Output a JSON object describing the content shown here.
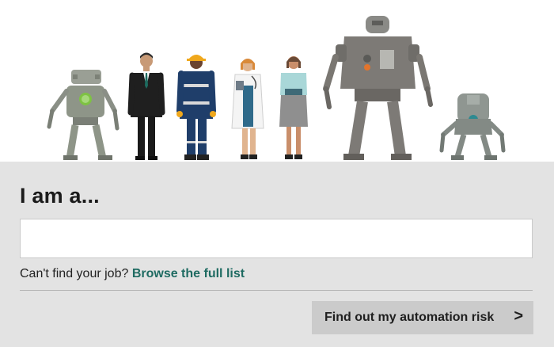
{
  "heading": "I am a...",
  "job_input": {
    "value": "",
    "placeholder": ""
  },
  "helper": {
    "prefix": "Can't find your job?",
    "link": "Browse the full list"
  },
  "submit": {
    "label": "Find out my automation risk",
    "icon": "chevron-right-icon"
  },
  "illustration": {
    "figures": [
      "small-robot-left-icon",
      "businessman-icon",
      "construction-worker-icon",
      "doctor-icon",
      "office-worker-icon",
      "large-robot-icon",
      "small-robot-right-icon"
    ]
  },
  "colors": {
    "panel_bg": "#e3e3e3",
    "link": "#1f6b62",
    "button_bg": "#cbcbcb"
  }
}
